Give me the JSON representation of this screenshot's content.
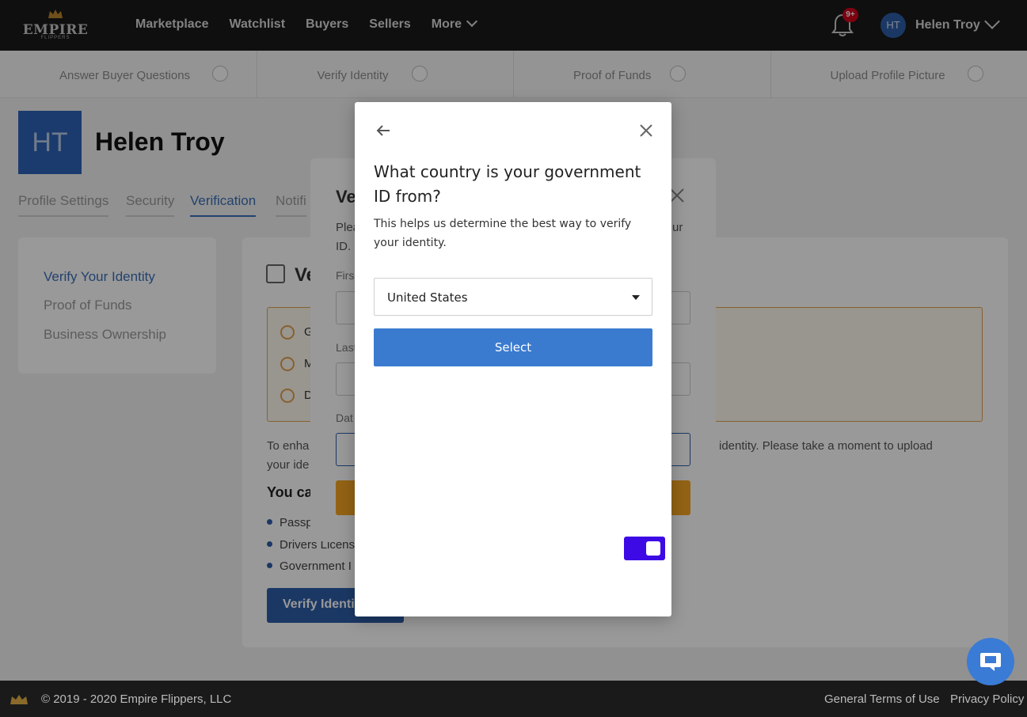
{
  "brand": {
    "name": "EMPIRE",
    "sub": "FLIPPERS"
  },
  "nav": {
    "links": [
      "Marketplace",
      "Watchlist",
      "Buyers",
      "Sellers",
      "More"
    ],
    "notifications_badge": "9+",
    "user_initials": "HT",
    "user_name": "Helen Troy"
  },
  "steps": [
    "Answer Buyer Questions",
    "Verify Identity",
    "Proof of Funds",
    "Upload Profile Picture"
  ],
  "profile": {
    "initials": "HT",
    "name": "Helen Troy",
    "tabs": [
      "Profile Settings",
      "Security",
      "Verification",
      "Notifi"
    ]
  },
  "sidebar": {
    "items": [
      "Verify Your Identity",
      "Proof of Funds",
      "Business Ownership"
    ]
  },
  "main": {
    "title": "Ve",
    "alerts": [
      "G",
      "M",
      "D"
    ],
    "para_start": "To enha",
    "para_tail": "identity. Please take a moment to upload",
    "para_line2": "your ide",
    "subheading": "You ca",
    "bullets": [
      "Passp",
      "Drivers Licens",
      "Government I"
    ],
    "button": "Verify Identit"
  },
  "back_modal": {
    "title": "Ve",
    "desc_start": "Plea",
    "desc_end": "ur",
    "desc_line2": "ID.",
    "labels": [
      "Firs",
      "Last",
      "Dat"
    ]
  },
  "modal": {
    "title": "What country is your government ID from?",
    "description": "This helps us determine the best way to verify your identity.",
    "country_value": "United States",
    "select_button": "Select"
  },
  "footer": {
    "copyright": "© 2019 - 2020 Empire Flippers, LLC",
    "terms": "General Terms of Use",
    "privacy": "Privacy Policy"
  },
  "colors": {
    "accent_blue": "#3a7bd0",
    "toggle_purple": "#3d0ae6",
    "warning_orange": "#e0a24e"
  }
}
